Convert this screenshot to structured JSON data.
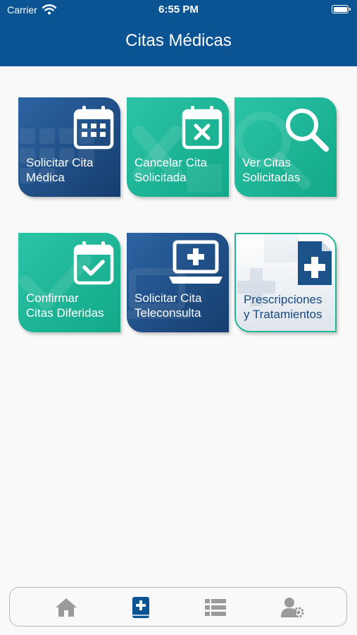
{
  "status_bar": {
    "carrier": "Carrier",
    "time": "6:55 PM"
  },
  "header": {
    "title": "Citas Médicas"
  },
  "tiles": [
    {
      "label": "Solicitar Cita\nMédica",
      "icon": "calendar-icon",
      "style": "blue"
    },
    {
      "label": "Cancelar Cita\nSolicitada",
      "icon": "calendar-x-icon",
      "style": "teal"
    },
    {
      "label": "Ver Citas\nSolicitadas",
      "icon": "search-icon",
      "style": "teal"
    },
    {
      "label": "Confirmar\nCitas Diferidas",
      "icon": "calendar-check-icon",
      "style": "teal"
    },
    {
      "label": "Solicitar Cita\nTeleconsulta",
      "icon": "laptop-medical-icon",
      "style": "blue"
    },
    {
      "label": "Prescripciones\ny Tratamientos",
      "icon": "medical-file-icon",
      "style": "light"
    }
  ],
  "tab_bar": {
    "items": [
      {
        "name": "home",
        "icon": "home-icon",
        "active": false
      },
      {
        "name": "citas",
        "icon": "medical-book-icon",
        "active": true
      },
      {
        "name": "list",
        "icon": "list-icon",
        "active": false
      },
      {
        "name": "user-settings",
        "icon": "user-gear-icon",
        "active": false
      }
    ]
  },
  "colors": {
    "header": "#0a5494",
    "tile_blue": "#1e4f87",
    "tile_teal": "#1db798",
    "tab_active": "#0a5494",
    "tab_inactive": "#9a9a9a"
  }
}
